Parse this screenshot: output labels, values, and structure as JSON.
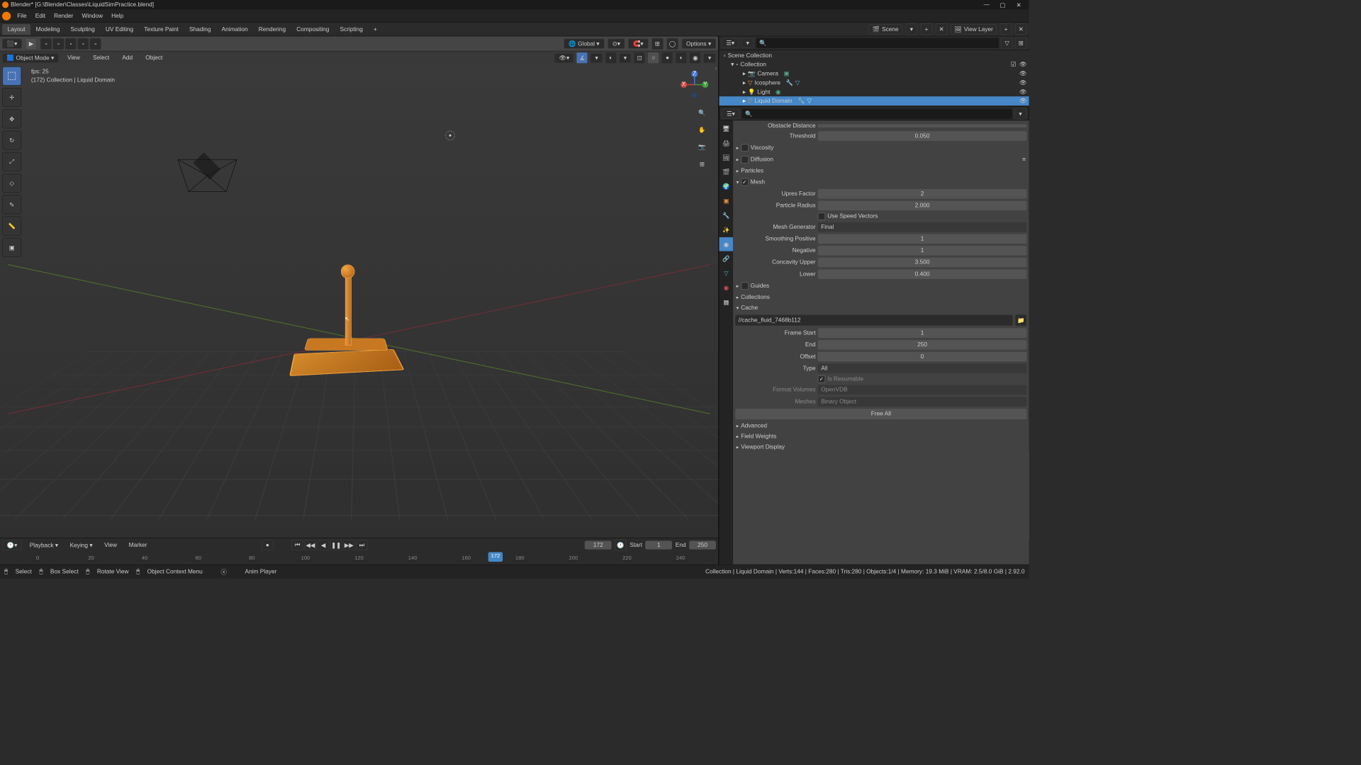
{
  "titlebar": {
    "title": "Blender* [G:\\Blender\\Classes\\LiquidSimPractice.blend]"
  },
  "menubar": {
    "items": [
      "File",
      "Edit",
      "Render",
      "Window",
      "Help"
    ]
  },
  "workspaces": {
    "tabs": [
      "Layout",
      "Modeling",
      "Sculpting",
      "UV Editing",
      "Texture Paint",
      "Shading",
      "Animation",
      "Rendering",
      "Compositing",
      "Scripting",
      "+"
    ],
    "active": 0
  },
  "scene_selector": {
    "label": "Scene"
  },
  "viewlayer_selector": {
    "label": "View Layer"
  },
  "viewport": {
    "mode_label": "Object Mode",
    "menu_items": [
      "View",
      "Select",
      "Add",
      "Object"
    ],
    "transform_orientation": "Global",
    "options_label": "Options",
    "overlay_fps": "fps: 25",
    "overlay_info": "(172) Collection | Liquid Domain"
  },
  "timeline": {
    "menus": [
      "Playback",
      "Keying",
      "View",
      "Marker"
    ],
    "current_frame": "172",
    "start_label": "Start",
    "start_value": "1",
    "end_label": "End",
    "end_value": "250",
    "ticks": [
      "0",
      "20",
      "40",
      "60",
      "80",
      "100",
      "120",
      "140",
      "160",
      "180",
      "200",
      "220",
      "240"
    ],
    "playhead": "172"
  },
  "statusbar": {
    "select_label": "Select",
    "box_select": "Box Select",
    "rotate_view": "Rotate View",
    "context_menu": "Object Context Menu",
    "anim_player": "Anim Player",
    "stats": "Collection | Liquid Domain | Verts:144 | Faces:280 | Tris:280 | Objects:1/4 | Memory: 19.3 MiB | VRAM: 2.5/8.0 GiB | 2.92.0"
  },
  "outliner": {
    "search_placeholder": "",
    "root": "Scene Collection",
    "collection": "Collection",
    "items": [
      {
        "name": "Camera"
      },
      {
        "name": "Icosphere"
      },
      {
        "name": "Light"
      },
      {
        "name": "Liquid Domain"
      }
    ]
  },
  "properties": {
    "search_placeholder": "",
    "obstacle_distance_label": "Obstacle Distance",
    "threshold_label": "Threshold",
    "threshold_value": "0.050",
    "viscosity_label": "Viscosity",
    "diffusion_label": "Diffusion",
    "particles_label": "Particles",
    "mesh_label": "Mesh",
    "upres_factor_label": "Upres Factor",
    "upres_factor_value": "2",
    "particle_radius_label": "Particle Radius",
    "particle_radius_value": "2.000",
    "use_speed_vectors_label": "Use Speed Vectors",
    "mesh_generator_label": "Mesh Generator",
    "mesh_generator_value": "Final",
    "smoothing_positive_label": "Smoothing Positive",
    "smoothing_positive_value": "1",
    "negative_label": "Negative",
    "negative_value": "1",
    "concavity_upper_label": "Concavity Upper",
    "concavity_upper_value": "3.500",
    "lower_label": "Lower",
    "lower_value": "0.400",
    "guides_label": "Guides",
    "collections_label": "Collections",
    "cache_label": "Cache",
    "cache_path": "//cache_fluid_7468b112",
    "frame_start_label": "Frame Start",
    "frame_start_value": "1",
    "frame_end_label": "End",
    "frame_end_value": "250",
    "offset_label": "Offset",
    "offset_value": "0",
    "type_label": "Type",
    "type_value": "All",
    "resumable_label": "Is Resumable",
    "format_volumes_label": "Format Volumes",
    "format_volumes_value": "OpenVDB",
    "meshes_label": "Meshes",
    "meshes_value": "Binary Object",
    "free_all_label": "Free All",
    "advanced_label": "Advanced",
    "field_weights_label": "Field Weights",
    "viewport_display_label": "Viewport Display"
  }
}
